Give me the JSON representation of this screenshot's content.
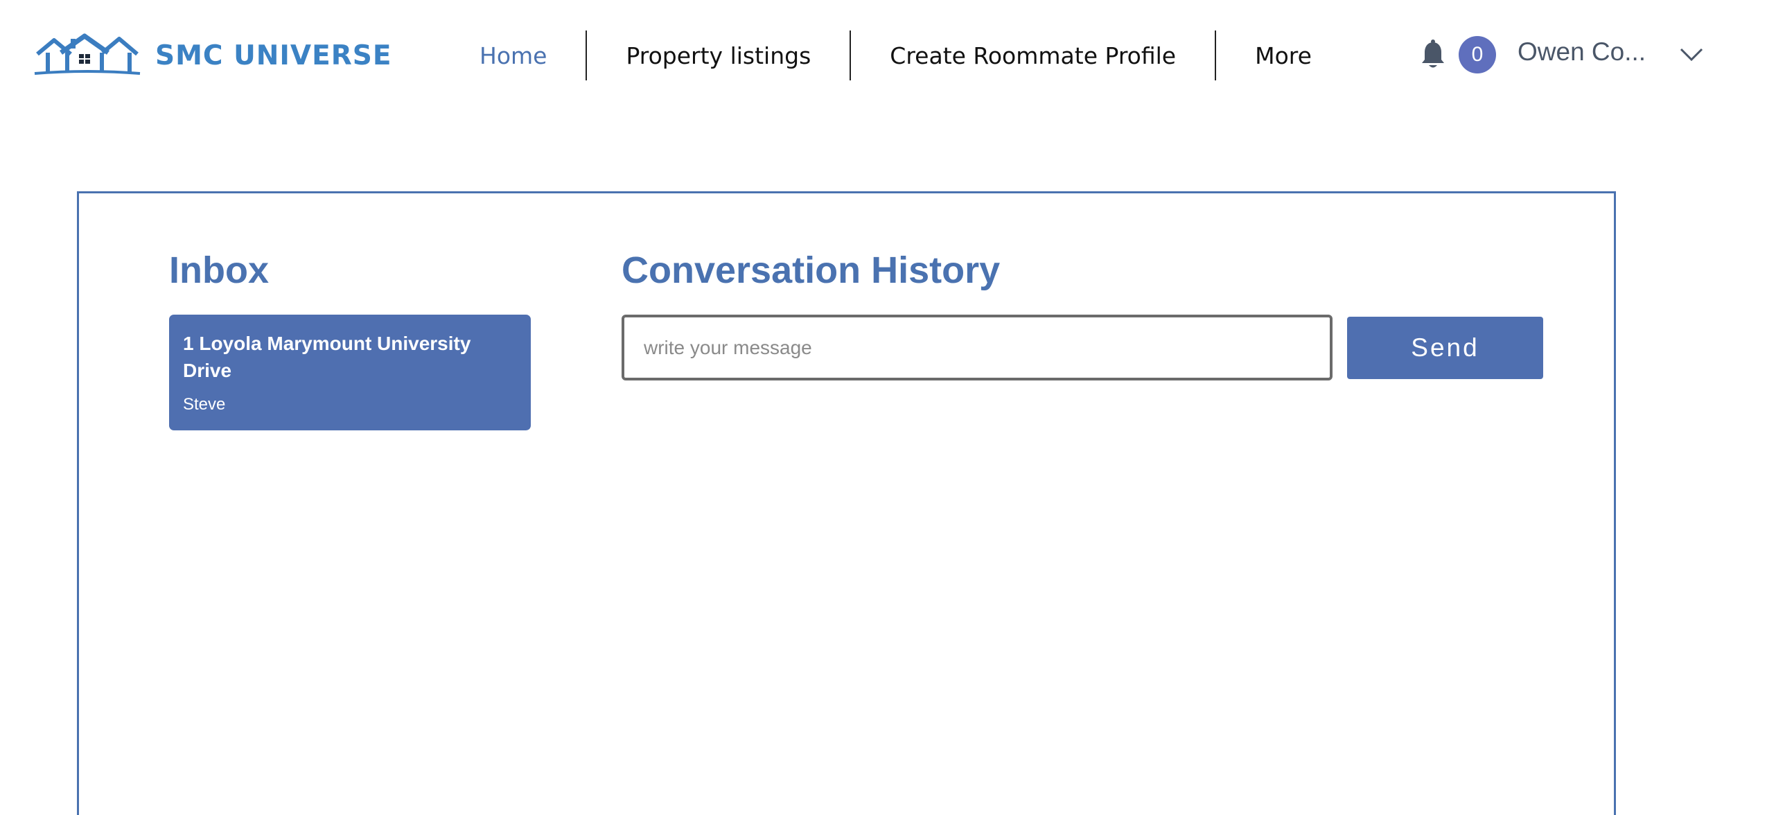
{
  "brand": {
    "name": "SMC UNIVERSE",
    "logo_icon": "houses-logo-icon",
    "color": "#3b82c4"
  },
  "nav": {
    "items": [
      {
        "label": "Home",
        "active": true
      },
      {
        "label": "Property listings"
      },
      {
        "label": "Create Roommate Profile"
      },
      {
        "label": "More"
      }
    ]
  },
  "user": {
    "notifications_icon": "bell-icon",
    "notification_count": "0",
    "name": "Owen Co...",
    "menu_icon": "chevron-down-icon"
  },
  "inbox": {
    "title": "Inbox",
    "items": [
      {
        "address": "1 Loyola Marymount University Drive",
        "sender": "Steve"
      }
    ]
  },
  "conversation": {
    "title": "Conversation History",
    "input_placeholder": "write your message",
    "input_value": "",
    "send_label": "Send"
  },
  "colors": {
    "accent": "#4a72b0",
    "button": "#4f6fb0",
    "badge": "#5f6fbd"
  }
}
